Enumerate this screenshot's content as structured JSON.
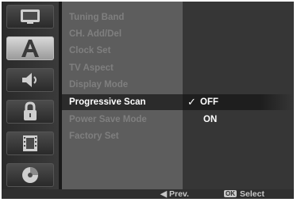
{
  "sidebar": {
    "tabs": [
      {
        "icon": "display-tv-icon",
        "active": false
      },
      {
        "icon": "language-a-icon",
        "active": true
      },
      {
        "icon": "audio-speaker-icon",
        "active": false
      },
      {
        "icon": "lock-icon",
        "active": false
      },
      {
        "icon": "film-icon",
        "active": false
      },
      {
        "icon": "disc-icon",
        "active": false
      }
    ]
  },
  "menu": {
    "items": [
      {
        "label": "Tuning Band",
        "selected": false
      },
      {
        "label": "CH. Add/Del",
        "selected": false
      },
      {
        "label": "Clock Set",
        "selected": false
      },
      {
        "label": "TV Aspect",
        "selected": false
      },
      {
        "label": "Display Mode",
        "selected": false
      },
      {
        "label": "Progressive Scan",
        "selected": true
      },
      {
        "label": "Power Save Mode",
        "selected": false
      },
      {
        "label": "Factory Set",
        "selected": false
      }
    ]
  },
  "options": {
    "items": [
      {
        "label": "OFF",
        "checked": true
      },
      {
        "label": "ON",
        "checked": false
      }
    ],
    "check_glyph": "✓"
  },
  "footer": {
    "prev_label": "◀ Prev.",
    "ok_badge": "OK",
    "select_label": "Select"
  },
  "colors": {
    "menu_bg": "#5d5d5d",
    "selected_bg": "#2b2b2b",
    "disabled_text": "#7f7f7f",
    "active_text": "#ffffff"
  }
}
